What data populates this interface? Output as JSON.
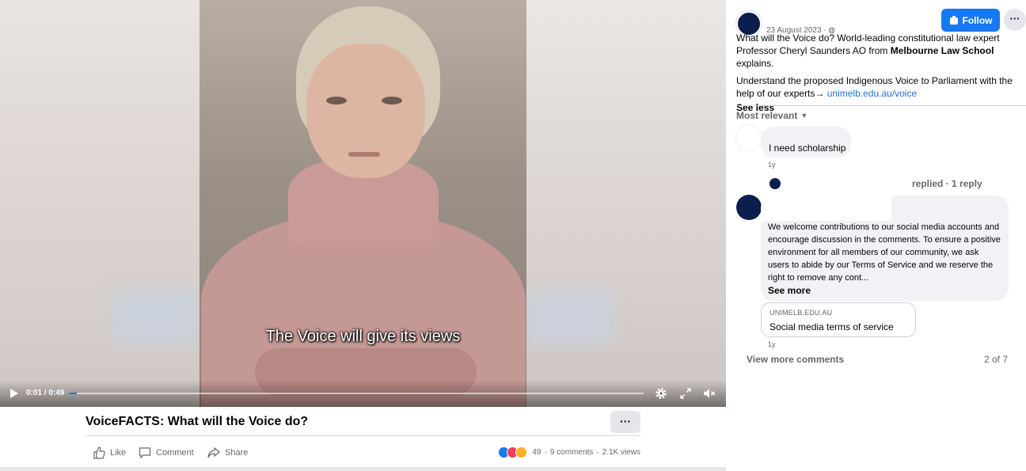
{
  "video": {
    "caption": "The Voice will give its views",
    "time": "0:01 / 0:49",
    "progress": 0.012
  },
  "post": {
    "title": "VoiceFACTS: What will the Voice do?",
    "more": "···",
    "actions": {
      "like": "Like",
      "comment": "Comment",
      "share": "Share"
    },
    "stats": {
      "reactions": "49",
      "comments": "9 comments",
      "views": "2.1K views"
    }
  },
  "panel": {
    "date": "23 August 2023 · ",
    "follow": "Follow",
    "more": "···",
    "text_p1_a": "What will the Voice do? World-leading constitutional law expert Professor Cheryl Saunders AO from ",
    "text_p1_b": "Melbourne Law School",
    "text_p1_c": " explains.",
    "text_p2_a": "Understand the proposed Indigenous Voice to Parliament with the help of our experts→ ",
    "text_p2_link": "unimelb.edu.au/voice",
    "see_less": "See less",
    "sort": "Most relevant",
    "comments": [
      {
        "text": "I need scholarship",
        "time": "1y"
      },
      {
        "reply_summary": "replied · 1 reply"
      },
      {
        "text": "We welcome contributions to our social media accounts and encourage discussion in the comments. To ensure a positive environment for all members of our community, we ask users to abide by our Terms of Service and we reserve the right to remove any cont...",
        "see_more": "See more",
        "link_domain": "UNIMELB.EDU.AU",
        "link_title": "Social media terms of service",
        "time": "1y"
      }
    ],
    "view_more": "View more comments",
    "pager": "2 of 7"
  },
  "colors": {
    "accent": "#1877f2",
    "like": "#1877f2",
    "love": "#f33e58",
    "haha": "#f7b125"
  }
}
